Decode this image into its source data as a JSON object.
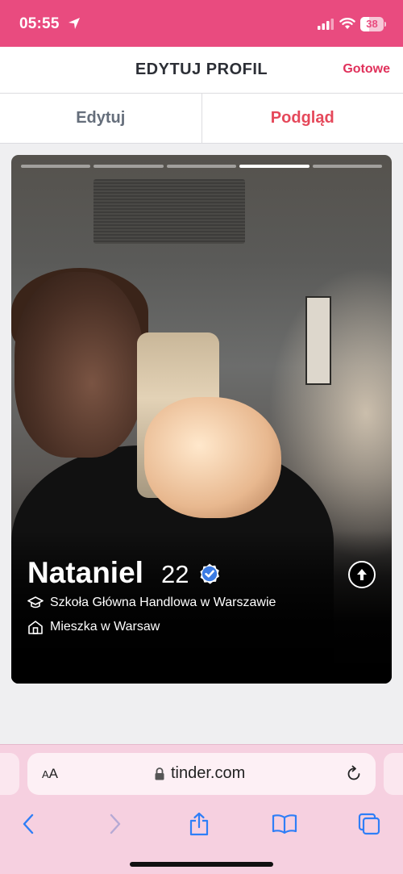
{
  "status_bar": {
    "time": "05:55",
    "battery": "38",
    "battery_level": 0.38
  },
  "header": {
    "title": "EDYTUJ PROFIL",
    "done_label": "Gotowe"
  },
  "tabs": [
    {
      "label": "Edytuj",
      "active": false
    },
    {
      "label": "Podgląd",
      "active": true
    }
  ],
  "card": {
    "photo_count": 5,
    "active_photo": 4,
    "name": "Nataniel",
    "age": "22",
    "verified": true,
    "school": "Szkoła Główna Handlowa w Warszawie",
    "home": "Mieszka w Warsaw"
  },
  "browser": {
    "text_size_label_large": "A",
    "text_size_label_small": "A",
    "url": "tinder.com"
  },
  "colors": {
    "brand": "#e94b7f",
    "accent": "#e0315b",
    "verified": "#3b7be3"
  },
  "icons": [
    "location-arrow-icon",
    "signal-icon",
    "wifi-icon",
    "battery-icon",
    "verified-badge-icon",
    "graduation-cap-icon",
    "home-icon",
    "arrow-up-icon",
    "lock-icon",
    "reload-icon",
    "back-icon",
    "forward-icon",
    "share-icon",
    "bookmarks-icon",
    "tabs-icon"
  ]
}
